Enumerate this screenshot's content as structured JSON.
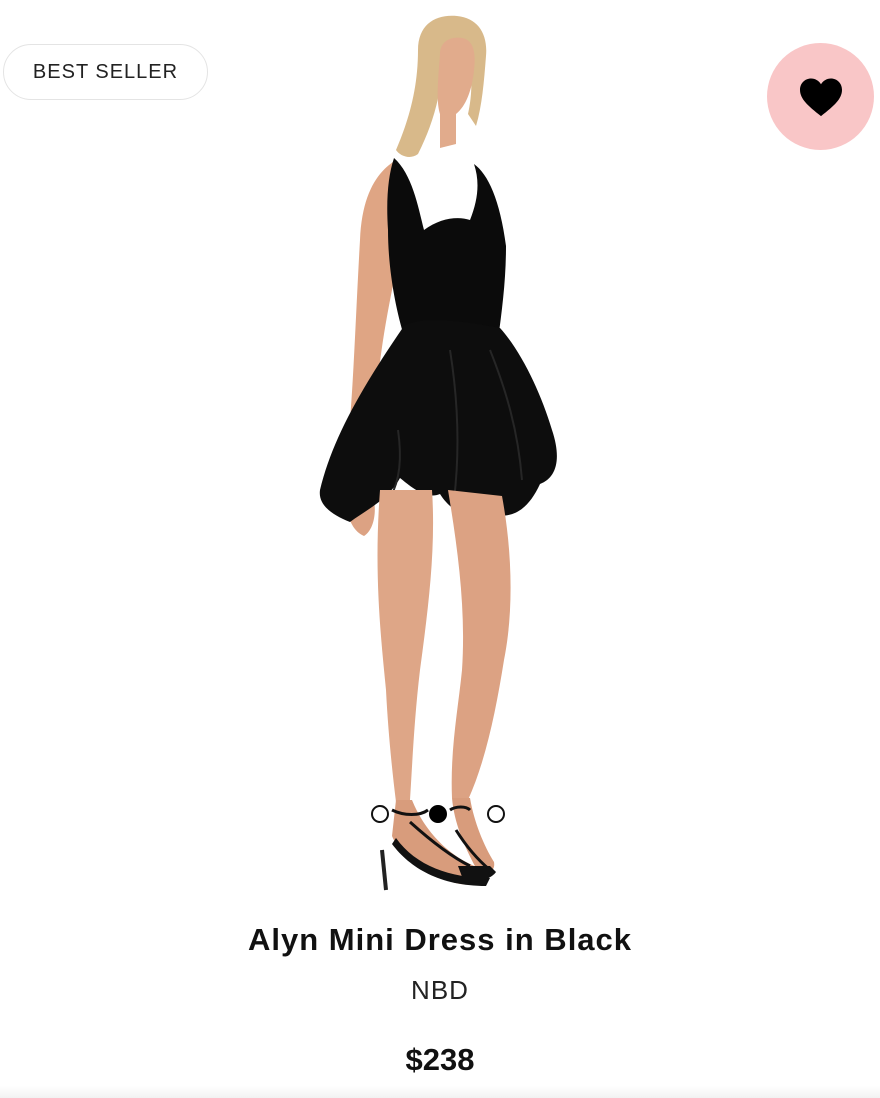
{
  "badge": {
    "label": "BEST SELLER"
  },
  "favorite": {
    "icon": "heart-icon",
    "circle_color": "#f9c6c7",
    "icon_color": "#000000"
  },
  "image": {
    "alt": "Alyn Mini Dress in Black"
  },
  "carousel": {
    "count": 3,
    "active_index": 1
  },
  "product": {
    "name": "Alyn Mini Dress in Black",
    "brand": "NBD",
    "price": "$238"
  }
}
